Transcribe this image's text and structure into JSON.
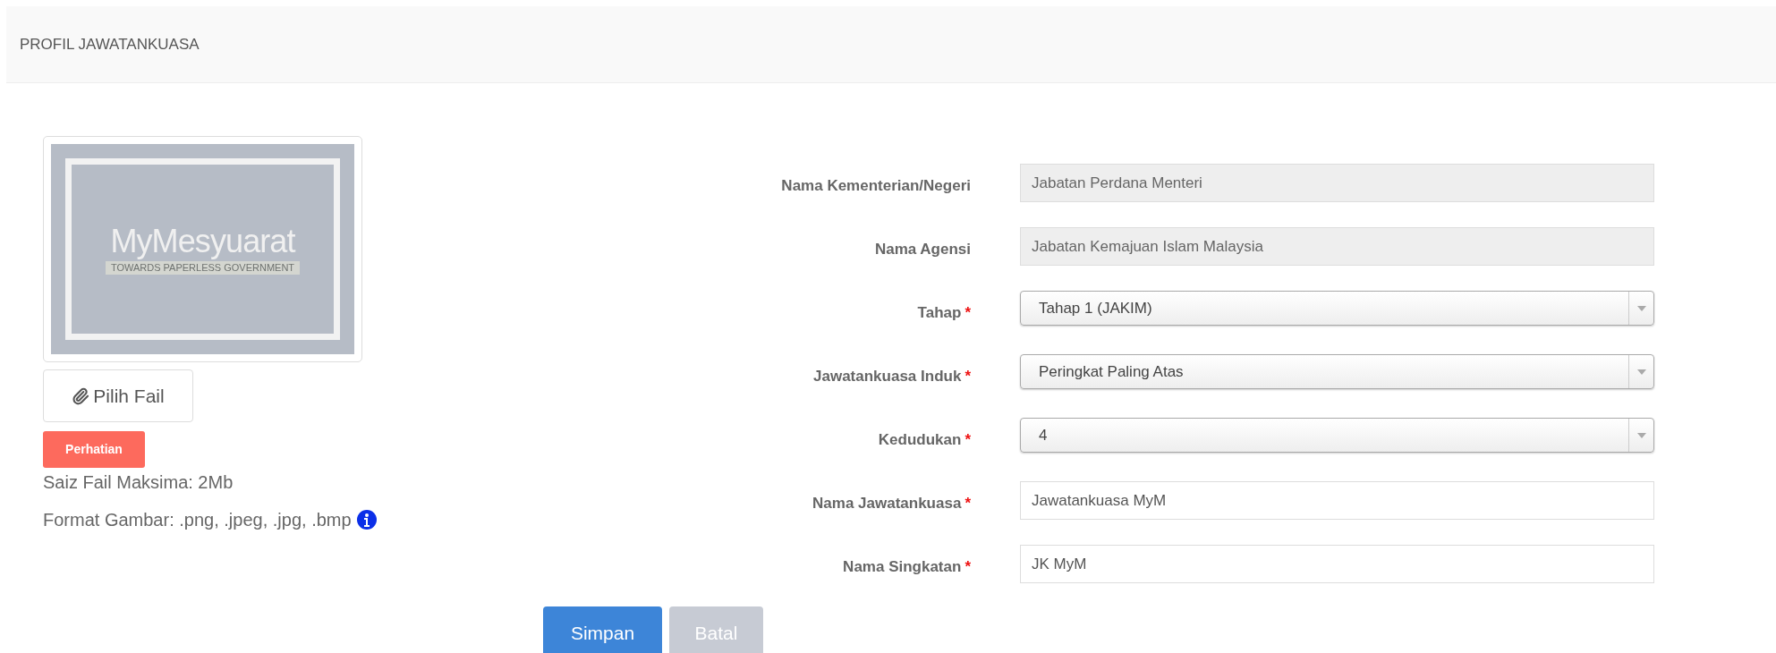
{
  "header": {
    "title": "PROFIL JAWATANKUASA"
  },
  "logo": {
    "title": "MyMesyuarat",
    "tagline": "TOWARDS PAPERLESS GOVERNMENT"
  },
  "upload_button": {
    "label": "Pilih Fail"
  },
  "notice": {
    "badge": "Perhatian",
    "lines": [
      "Saiz Fail Maksima: 2Mb",
      "Format Gambar: .png, .jpeg, .jpg, .bmp"
    ]
  },
  "fields": [
    {
      "label": "Nama Kementerian/Negeri",
      "kind": "readonly",
      "value": "Jabatan Perdana Menteri"
    },
    {
      "label": "Nama Agensi",
      "kind": "readonly",
      "value": "Jabatan Kemajuan Islam Malaysia"
    },
    {
      "label": "Tahap",
      "kind": "select",
      "mark": "*",
      "value": "Tahap 1 (JAKIM)"
    },
    {
      "label": "Jawatankuasa Induk",
      "kind": "select",
      "mark": "*",
      "value": "Peringkat Paling Atas"
    },
    {
      "label": "Kedudukan",
      "kind": "select",
      "mark": "*",
      "value": "4"
    },
    {
      "label": "Nama Jawatankuasa",
      "kind": "text",
      "mark": "*",
      "value": "Jawatankuasa MyM"
    },
    {
      "label": "Nama Singkatan",
      "kind": "text",
      "mark": "*",
      "value": "JK MyM"
    }
  ],
  "buttons": [
    {
      "label": "Simpan",
      "kind": "primary"
    },
    {
      "label": "Batal",
      "kind": "secondary"
    }
  ]
}
